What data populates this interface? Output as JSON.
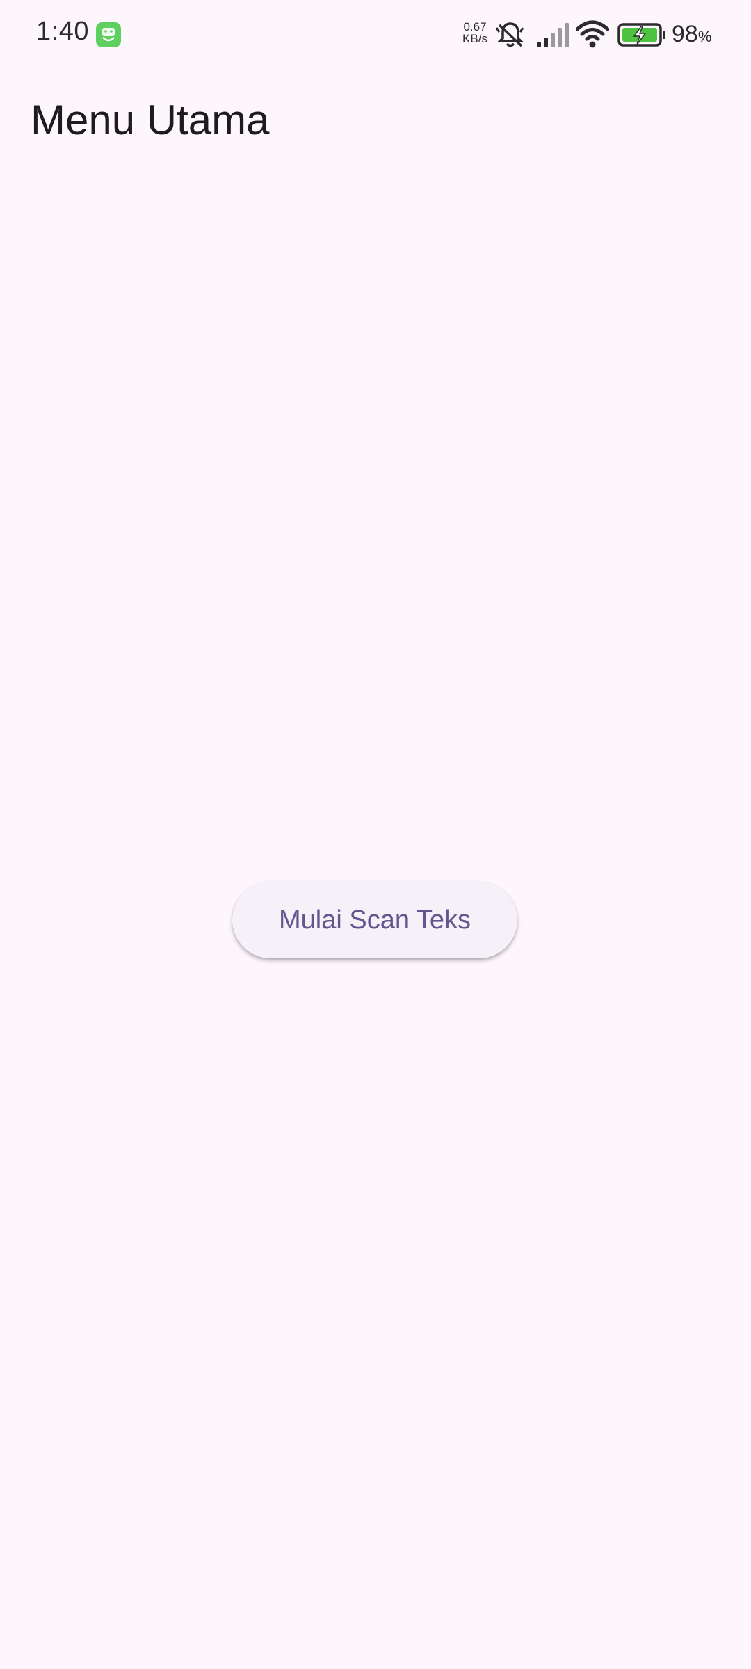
{
  "status_bar": {
    "time": "1:40",
    "net_speed_value": "0.67",
    "net_speed_unit": "KB/s",
    "battery_value": "98",
    "battery_unit": "%",
    "icons": [
      "app-notification-icon",
      "bell-muted-icon",
      "signal-icon",
      "wifi-icon",
      "battery-charging-icon"
    ]
  },
  "header": {
    "title": "Menu Utama"
  },
  "main": {
    "scan_button_label": "Mulai Scan Teks"
  },
  "colors": {
    "background": "#fdf7fd",
    "button_background": "#f6f1f8",
    "button_text": "#65558f",
    "title_text": "#1d1b20",
    "battery_fill": "#4cc43f",
    "app_icon": "#5fcf5f"
  }
}
